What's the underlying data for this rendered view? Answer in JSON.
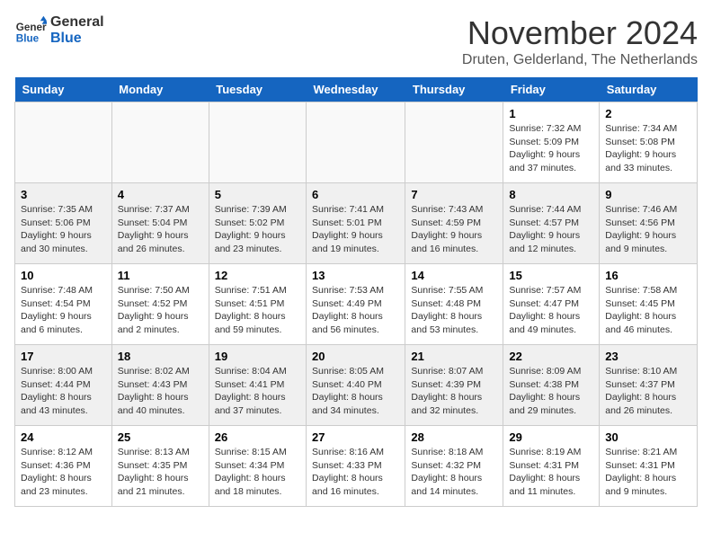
{
  "header": {
    "logo_line1": "General",
    "logo_line2": "Blue",
    "month": "November 2024",
    "location": "Druten, Gelderland, The Netherlands"
  },
  "days_of_week": [
    "Sunday",
    "Monday",
    "Tuesday",
    "Wednesday",
    "Thursday",
    "Friday",
    "Saturday"
  ],
  "weeks": [
    [
      {
        "num": "",
        "info": ""
      },
      {
        "num": "",
        "info": ""
      },
      {
        "num": "",
        "info": ""
      },
      {
        "num": "",
        "info": ""
      },
      {
        "num": "",
        "info": ""
      },
      {
        "num": "1",
        "info": "Sunrise: 7:32 AM\nSunset: 5:09 PM\nDaylight: 9 hours and 37 minutes."
      },
      {
        "num": "2",
        "info": "Sunrise: 7:34 AM\nSunset: 5:08 PM\nDaylight: 9 hours and 33 minutes."
      }
    ],
    [
      {
        "num": "3",
        "info": "Sunrise: 7:35 AM\nSunset: 5:06 PM\nDaylight: 9 hours and 30 minutes."
      },
      {
        "num": "4",
        "info": "Sunrise: 7:37 AM\nSunset: 5:04 PM\nDaylight: 9 hours and 26 minutes."
      },
      {
        "num": "5",
        "info": "Sunrise: 7:39 AM\nSunset: 5:02 PM\nDaylight: 9 hours and 23 minutes."
      },
      {
        "num": "6",
        "info": "Sunrise: 7:41 AM\nSunset: 5:01 PM\nDaylight: 9 hours and 19 minutes."
      },
      {
        "num": "7",
        "info": "Sunrise: 7:43 AM\nSunset: 4:59 PM\nDaylight: 9 hours and 16 minutes."
      },
      {
        "num": "8",
        "info": "Sunrise: 7:44 AM\nSunset: 4:57 PM\nDaylight: 9 hours and 12 minutes."
      },
      {
        "num": "9",
        "info": "Sunrise: 7:46 AM\nSunset: 4:56 PM\nDaylight: 9 hours and 9 minutes."
      }
    ],
    [
      {
        "num": "10",
        "info": "Sunrise: 7:48 AM\nSunset: 4:54 PM\nDaylight: 9 hours and 6 minutes."
      },
      {
        "num": "11",
        "info": "Sunrise: 7:50 AM\nSunset: 4:52 PM\nDaylight: 9 hours and 2 minutes."
      },
      {
        "num": "12",
        "info": "Sunrise: 7:51 AM\nSunset: 4:51 PM\nDaylight: 8 hours and 59 minutes."
      },
      {
        "num": "13",
        "info": "Sunrise: 7:53 AM\nSunset: 4:49 PM\nDaylight: 8 hours and 56 minutes."
      },
      {
        "num": "14",
        "info": "Sunrise: 7:55 AM\nSunset: 4:48 PM\nDaylight: 8 hours and 53 minutes."
      },
      {
        "num": "15",
        "info": "Sunrise: 7:57 AM\nSunset: 4:47 PM\nDaylight: 8 hours and 49 minutes."
      },
      {
        "num": "16",
        "info": "Sunrise: 7:58 AM\nSunset: 4:45 PM\nDaylight: 8 hours and 46 minutes."
      }
    ],
    [
      {
        "num": "17",
        "info": "Sunrise: 8:00 AM\nSunset: 4:44 PM\nDaylight: 8 hours and 43 minutes."
      },
      {
        "num": "18",
        "info": "Sunrise: 8:02 AM\nSunset: 4:43 PM\nDaylight: 8 hours and 40 minutes."
      },
      {
        "num": "19",
        "info": "Sunrise: 8:04 AM\nSunset: 4:41 PM\nDaylight: 8 hours and 37 minutes."
      },
      {
        "num": "20",
        "info": "Sunrise: 8:05 AM\nSunset: 4:40 PM\nDaylight: 8 hours and 34 minutes."
      },
      {
        "num": "21",
        "info": "Sunrise: 8:07 AM\nSunset: 4:39 PM\nDaylight: 8 hours and 32 minutes."
      },
      {
        "num": "22",
        "info": "Sunrise: 8:09 AM\nSunset: 4:38 PM\nDaylight: 8 hours and 29 minutes."
      },
      {
        "num": "23",
        "info": "Sunrise: 8:10 AM\nSunset: 4:37 PM\nDaylight: 8 hours and 26 minutes."
      }
    ],
    [
      {
        "num": "24",
        "info": "Sunrise: 8:12 AM\nSunset: 4:36 PM\nDaylight: 8 hours and 23 minutes."
      },
      {
        "num": "25",
        "info": "Sunrise: 8:13 AM\nSunset: 4:35 PM\nDaylight: 8 hours and 21 minutes."
      },
      {
        "num": "26",
        "info": "Sunrise: 8:15 AM\nSunset: 4:34 PM\nDaylight: 8 hours and 18 minutes."
      },
      {
        "num": "27",
        "info": "Sunrise: 8:16 AM\nSunset: 4:33 PM\nDaylight: 8 hours and 16 minutes."
      },
      {
        "num": "28",
        "info": "Sunrise: 8:18 AM\nSunset: 4:32 PM\nDaylight: 8 hours and 14 minutes."
      },
      {
        "num": "29",
        "info": "Sunrise: 8:19 AM\nSunset: 4:31 PM\nDaylight: 8 hours and 11 minutes."
      },
      {
        "num": "30",
        "info": "Sunrise: 8:21 AM\nSunset: 4:31 PM\nDaylight: 8 hours and 9 minutes."
      }
    ]
  ]
}
